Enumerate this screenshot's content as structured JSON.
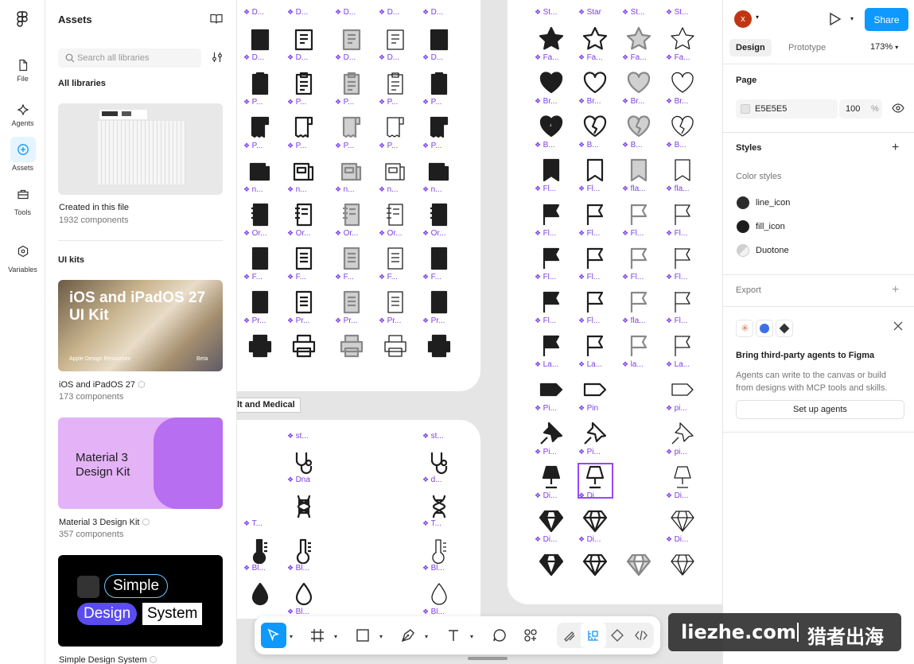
{
  "colors": {
    "accent": "#0d99ff",
    "component_purple": "#7b3fe4",
    "canvas_bg": "#e5e5e5",
    "icon_dark": "#1e1e1e"
  },
  "rail": {
    "items": [
      {
        "label": "File",
        "icon": "file-icon"
      },
      {
        "label": "Agents",
        "icon": "sparkle-icon"
      },
      {
        "label": "Assets",
        "icon": "assets-icon"
      },
      {
        "label": "Tools",
        "icon": "toolbox-icon"
      },
      {
        "label": "Variables",
        "icon": "hexagon-icon"
      }
    ]
  },
  "assets": {
    "title": "Assets",
    "search_placeholder": "Search all libraries",
    "all_libraries": "All libraries",
    "local": {
      "name": "Created in this file",
      "count": "1932 components"
    },
    "ui_kits_heading": "UI kits",
    "kits": [
      {
        "name": "iOS and iPadOS 27",
        "count": "173 components",
        "thumb_title": "iOS and iPadOS 27 UI Kit",
        "thumb_footer": "Apple Design Resources",
        "thumb_badge": "Beta"
      },
      {
        "name": "Material 3 Design Kit",
        "count": "357 components",
        "thumb_title": "Material 3 Design Kit"
      },
      {
        "name": "Simple Design System",
        "thumb_words": [
          "Simple",
          "Design",
          "System"
        ]
      }
    ]
  },
  "canvas": {
    "frame_label": "lt and Medical",
    "top_row_labels": [
      "D...",
      "D...",
      "D...",
      "D...",
      "D..."
    ],
    "left_rows": [
      [
        "D...",
        "D...",
        "D...",
        "D...",
        "D..."
      ],
      [
        "P...",
        "P...",
        "P...",
        "P...",
        "P..."
      ],
      [
        "P...",
        "P...",
        "P...",
        "P...",
        "P..."
      ],
      [
        "n...",
        "n...",
        "n...",
        "n...",
        "n..."
      ],
      [
        "Or...",
        "Or...",
        "Or...",
        "Or...",
        "Or..."
      ],
      [
        "F...",
        "F...",
        "F...",
        "F...",
        "F..."
      ],
      [
        "Pr...",
        "Pr...",
        "Pr...",
        "Pr...",
        "Pr..."
      ]
    ],
    "right_top_labels": [
      "St...",
      "Star",
      "St...",
      "St..."
    ],
    "right_rows": [
      [
        "Fa...",
        "Fa...",
        "Fa...",
        "Fa..."
      ],
      [
        "Br...",
        "Br...",
        "Br...",
        "Br..."
      ],
      [
        "B...",
        "B...",
        "B...",
        "B..."
      ],
      [
        "Fl...",
        "Fl...",
        "fla...",
        "fla..."
      ],
      [
        "Fl...",
        "Fl...",
        "Fl...",
        "Fl..."
      ],
      [
        "Fl...",
        "Fl...",
        "Fl...",
        "Fl..."
      ],
      [
        "Fl...",
        "Fl...",
        "fla...",
        "Fl..."
      ],
      [
        "La...",
        "La...",
        "la...",
        "La..."
      ],
      [
        "Pi...",
        "Pin",
        "",
        "pi..."
      ],
      [
        "Pi...",
        "Pi...",
        "",
        "pi..."
      ],
      [
        "Di...",
        "Di...",
        "",
        "Di..."
      ],
      [
        "Di...",
        "Di...",
        "",
        "Di..."
      ]
    ],
    "medical_top_labels": [
      "st...",
      "st..."
    ],
    "medical_labels": [
      "Dna",
      "d...",
      "T...",
      "T...",
      "Bl...",
      "Bl...",
      "Bl...",
      "Bl...",
      "Bl..."
    ]
  },
  "right_panel": {
    "avatar_letter": "x",
    "share_label": "Share",
    "tabs": [
      "Design",
      "Prototype"
    ],
    "zoom": "173%",
    "page_heading": "Page",
    "page_color": "E5E5E5",
    "page_opacity": "100",
    "percent": "%",
    "styles_heading": "Styles",
    "color_styles_heading": "Color styles",
    "color_styles": [
      {
        "name": "line_icon",
        "color": "#2c2c2c"
      },
      {
        "name": "fill_icon",
        "color": "#1e1e1e"
      },
      {
        "name": "Duotone",
        "color": "#d9d9d9"
      }
    ],
    "export_heading": "Export",
    "agents_title": "Bring third-party agents to Figma",
    "agents_desc": "Agents can write to the canvas or build from designs with MCP tools and skills.",
    "setup_button": "Set up agents"
  },
  "toolbar": {
    "tools": [
      "move-tool",
      "frame-tool",
      "shape-tool",
      "pen-tool",
      "text-tool",
      "comment-tool",
      "actions-tool"
    ],
    "modes": [
      "draw-mode",
      "design-mode",
      "dev-mode-component",
      "dev-mode"
    ]
  },
  "watermark": {
    "left": "liezhe.com",
    "right": "猎者出海"
  }
}
